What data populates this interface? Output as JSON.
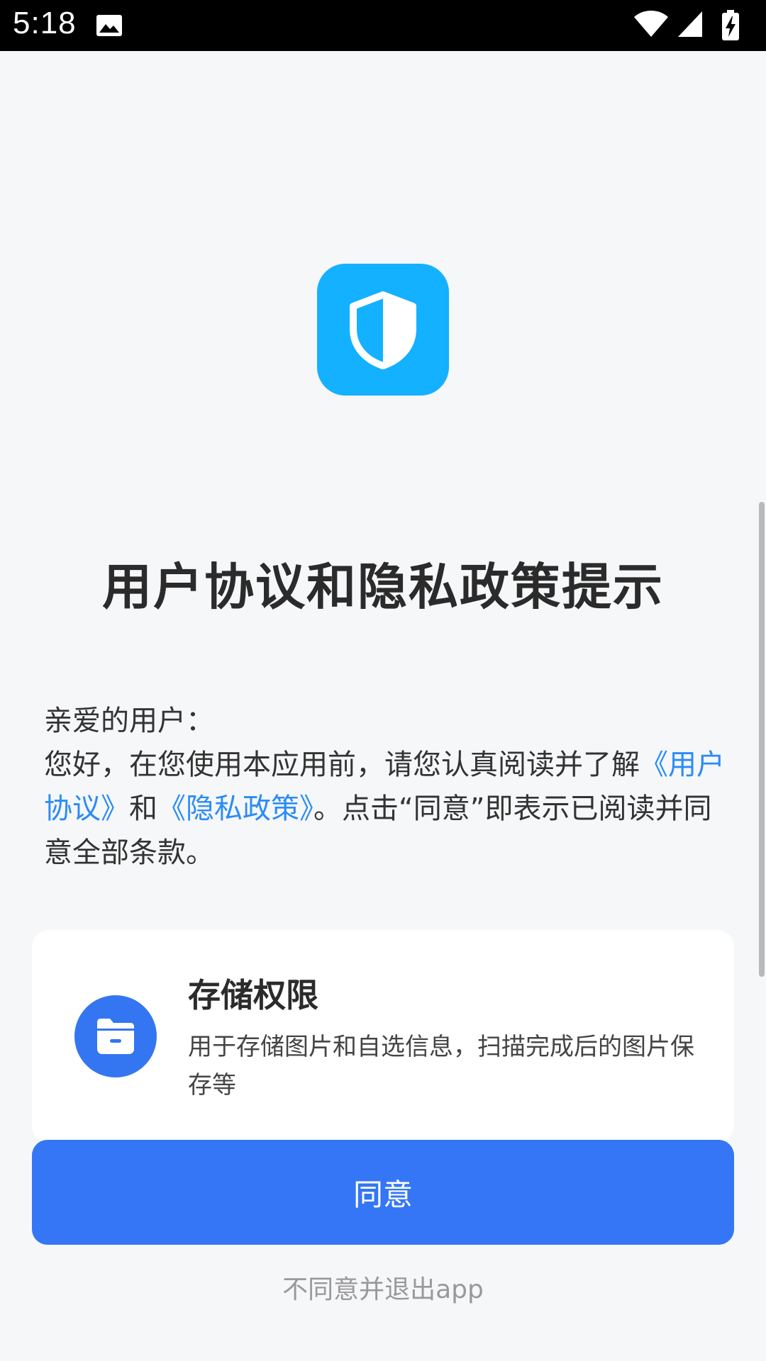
{
  "status_bar": {
    "time": "5:18"
  },
  "dialog": {
    "title": "用户协议和隐私政策提示",
    "greeting": "亲爱的用户：",
    "body_prefix": "您好，在您使用本应用前，请您认真阅读并了解",
    "user_agreement_link": "《用户协议》",
    "conjunction": "和",
    "privacy_policy_link": "《隐私政策》",
    "body_suffix": "。点击“同意”即表示已阅读并同意全部条款。"
  },
  "permission": {
    "title": "存储权限",
    "description": "用于存储图片和自选信息，扫描完成后的图片保存等",
    "icon": "folder-icon"
  },
  "actions": {
    "agree_label": "同意",
    "disagree_label": "不同意并退出app"
  },
  "colors": {
    "app_icon_bg": "#13b1ff",
    "accent_blue": "#3476f5",
    "link_blue": "#2a8cf7",
    "page_bg": "#f6f7f9"
  }
}
